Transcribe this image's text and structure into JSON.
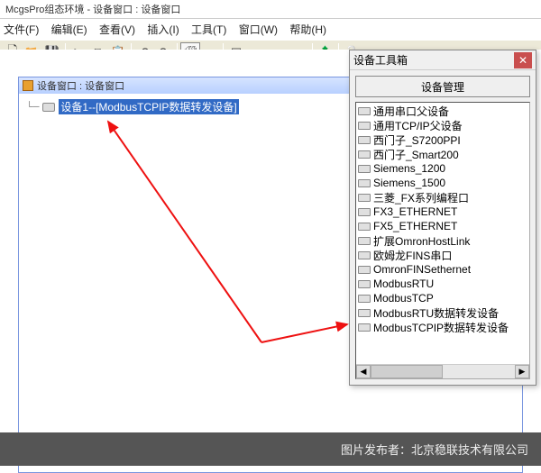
{
  "app_title": "McgsPro组态环境 - 设备窗口 : 设备窗口",
  "menu": [
    "文件(F)",
    "编辑(E)",
    "查看(V)",
    "插入(I)",
    "工具(T)",
    "窗口(W)",
    "帮助(H)"
  ],
  "child_window_title": "设备窗口 : 设备窗口",
  "tree_item": "设备1--[ModbusTCPIP数据转发设备]",
  "toolbox": {
    "title": "设备工具箱",
    "mgmt_button": "设备管理",
    "items": [
      "通用串口父设备",
      "通用TCP/IP父设备",
      "西门子_S7200PPI",
      "西门子_Smart200",
      "Siemens_1200",
      "Siemens_1500",
      "三菱_FX系列编程口",
      "FX3_ETHERNET",
      "FX5_ETHERNET",
      "扩展OmronHostLink",
      "欧姆龙FINS串口",
      "OmronFINSethernet",
      "ModbusRTU",
      "ModbusTCP",
      "ModbusRTU数据转发设备",
      "ModbusTCPIP数据转发设备"
    ]
  },
  "footer": "图片发布者：北京稳联技术有限公司"
}
